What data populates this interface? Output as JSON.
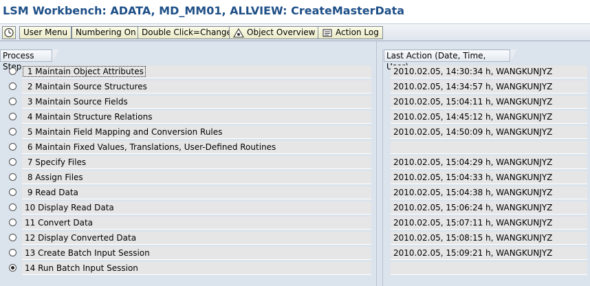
{
  "window": {
    "title": "LSM Workbench: ADATA, MD_MM01, ALLVIEW: CreateMasterData"
  },
  "toolbar": {
    "buttons": [
      {
        "label": "",
        "icon": "clock-icon"
      },
      {
        "label": "User Menu"
      },
      {
        "label": "Numbering On"
      },
      {
        "label": "Double Click=Change"
      },
      {
        "label": "Object Overview",
        "icon": "object-overview-icon"
      },
      {
        "label": "Action Log",
        "icon": "action-log-icon"
      }
    ]
  },
  "process_panel": {
    "header": "Process Step"
  },
  "action_panel": {
    "header": "Last Action (Date, Time, User)"
  },
  "steps": [
    {
      "label": " 1 Maintain Object Attributes",
      "last_action": "2010.02.05, 14:30:34 h, WANGKUNJYZ",
      "selected": false
    },
    {
      "label": " 2 Maintain Source Structures",
      "last_action": "2010.02.05, 14:34:57 h, WANGKUNJYZ",
      "selected": false
    },
    {
      "label": " 3 Maintain Source Fields",
      "last_action": "2010.02.05, 15:04:11 h, WANGKUNJYZ",
      "selected": false
    },
    {
      "label": " 4 Maintain Structure Relations",
      "last_action": "2010.02.05, 14:45:12 h, WANGKUNJYZ",
      "selected": false
    },
    {
      "label": " 5 Maintain Field Mapping and Conversion Rules",
      "last_action": "2010.02.05, 14:50:09 h, WANGKUNJYZ",
      "selected": false
    },
    {
      "label": " 6 Maintain Fixed Values, Translations, User-Defined Routines",
      "last_action": "",
      "selected": false
    },
    {
      "label": " 7 Specify Files",
      "last_action": "2010.02.05, 15:04:29 h, WANGKUNJYZ",
      "selected": false
    },
    {
      "label": " 8 Assign Files",
      "last_action": "2010.02.05, 15:04:33 h, WANGKUNJYZ",
      "selected": false
    },
    {
      "label": " 9 Read Data",
      "last_action": "2010.02.05, 15:04:38 h, WANGKUNJYZ",
      "selected": false
    },
    {
      "label": "10 Display Read Data",
      "last_action": "2010.02.05, 15:06:24 h, WANGKUNJYZ",
      "selected": false
    },
    {
      "label": "11 Convert Data",
      "last_action": "2010.02.05, 15:07:11 h, WANGKUNJYZ",
      "selected": false
    },
    {
      "label": "12 Display Converted Data",
      "last_action": "2010.02.05, 15:08:15 h, WANGKUNJYZ",
      "selected": false
    },
    {
      "label": "13 Create Batch Input Session",
      "last_action": "2010.02.05, 15:09:21 h, WANGKUNJYZ",
      "selected": false
    },
    {
      "label": "14 Run Batch Input Session",
      "last_action": "",
      "selected": true
    }
  ]
}
